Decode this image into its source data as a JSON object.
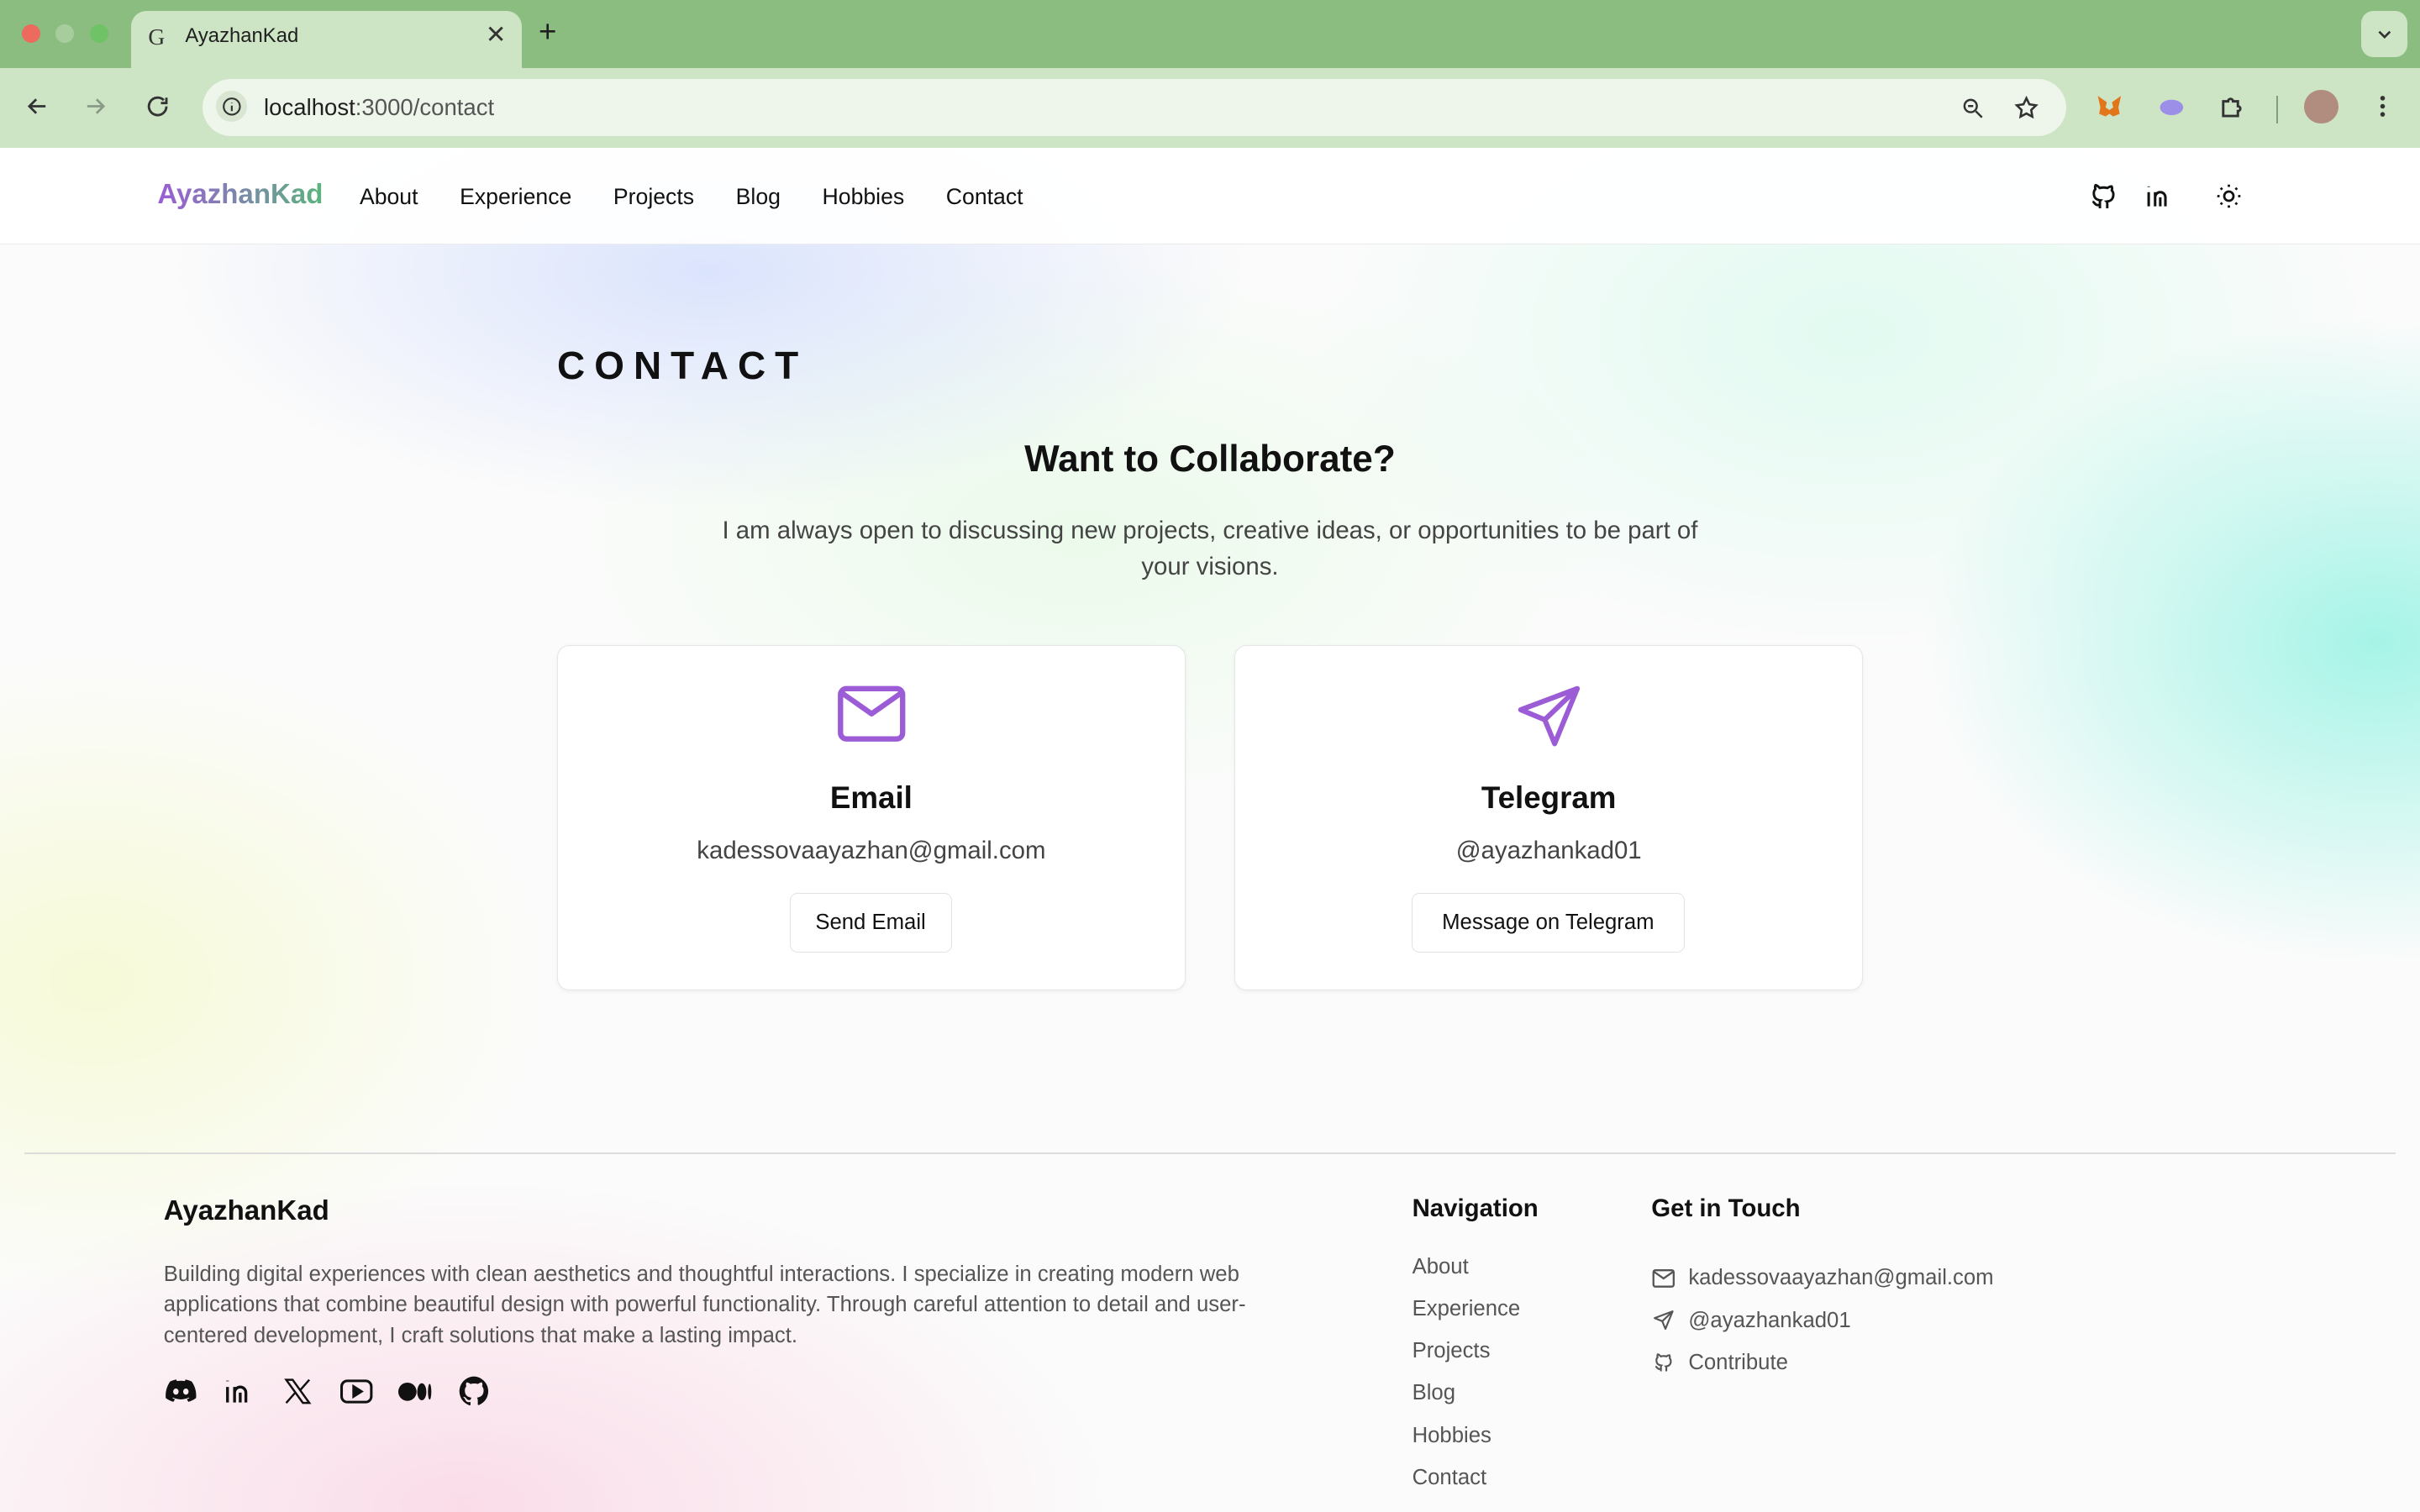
{
  "browser": {
    "tab_title": "AyazhanKad",
    "tab_favicon": "G",
    "url_host": "localhost",
    "url_rest": ":3000/contact"
  },
  "header": {
    "brand": "AyazhanKad",
    "nav": [
      "About",
      "Experience",
      "Projects",
      "Blog",
      "Hobbies",
      "Contact"
    ]
  },
  "main": {
    "section_title": "CONTACT",
    "headline": "Want to Collaborate?",
    "intro": "I am always open to discussing new projects, creative ideas, or opportunities to be part of your visions.",
    "cards": [
      {
        "icon": "mail-icon",
        "title": "Email",
        "value": "kadessovaayazhan@gmail.com",
        "button": "Send Email"
      },
      {
        "icon": "send-icon",
        "title": "Telegram",
        "value": "@ayazhankad01",
        "button": "Message on Telegram"
      }
    ]
  },
  "footer": {
    "brand": "AyazhanKad",
    "description": "Building digital experiences with clean aesthetics and thoughtful interactions. I specialize in creating modern web applications that combine beautiful design with powerful functionality. Through careful attention to detail and user-centered development, I craft solutions that make a lasting impact.",
    "social_icons": [
      "discord-icon",
      "linkedin-icon",
      "x-icon",
      "youtube-icon",
      "medium-icon",
      "github-icon"
    ],
    "nav_heading": "Navigation",
    "nav_links": [
      "About",
      "Experience",
      "Projects",
      "Blog",
      "Hobbies",
      "Contact"
    ],
    "touch_heading": "Get in Touch",
    "touch": [
      {
        "icon": "mail-icon",
        "text": "kadessovaayazhan@gmail.com"
      },
      {
        "icon": "send-icon",
        "text": "@ayazhankad01"
      },
      {
        "icon": "github-icon",
        "text": "Contribute"
      }
    ]
  },
  "colors": {
    "accent": "#9b5cd6",
    "brand_gradient_end": "#5bb47e",
    "chrome": "#8bbd80"
  }
}
